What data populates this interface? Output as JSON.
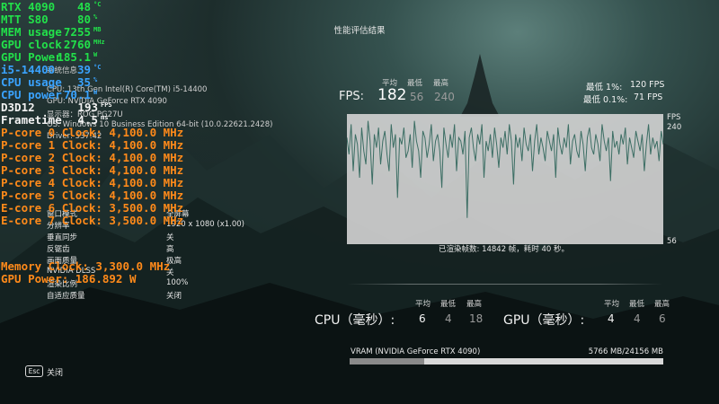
{
  "title": "性能评估结果",
  "osd": [
    {
      "label": "RTX 4090",
      "value": "48",
      "unit": "°C",
      "color": "c-green"
    },
    {
      "label": "MTT S80",
      "value": "80",
      "unit": "%",
      "color": "c-green"
    },
    {
      "label": "MEM usage",
      "value": "7255",
      "unit": "MB",
      "color": "c-green"
    },
    {
      "label": "GPU clock",
      "value": "2760",
      "unit": "MHz",
      "color": "c-green"
    },
    {
      "label": "GPU Power",
      "value": "185.1",
      "unit": "W",
      "color": "c-green"
    },
    {
      "label": "i5-14400",
      "value": "39",
      "unit": "°C",
      "color": "c-blue"
    },
    {
      "label": "CPU usage",
      "value": "35",
      "unit": "%",
      "color": "c-blue"
    },
    {
      "label": "CPU power",
      "value": "70.1",
      "unit": "W",
      "color": "c-blue"
    },
    {
      "label": "D3D12",
      "value": "193",
      "unit": "FPS",
      "color": "c-white"
    },
    {
      "label": "Frametime",
      "value": "4.5",
      "unit": "ms",
      "color": "c-white"
    }
  ],
  "osd_clocks": [
    "P-core 0 Clock: 4,100.0 MHz",
    "P-core 1 Clock: 4,100.0 MHz",
    "P-core 2 Clock: 4,100.0 MHz",
    "P-core 3 Clock: 4,100.0 MHz",
    "P-core 4 Clock: 4,100.0 MHz",
    "P-core 5 Clock: 4,100.0 MHz",
    "E-core 6 Clock: 3,500.0 MHz",
    "E-core 7 Clock: 3,500.0 MHz"
  ],
  "osd_bottom": [
    "Memory Clock: 3,300.0 MHz",
    "GPU Power: 186.892 W"
  ],
  "sysinfo": {
    "header": "系统信息",
    "cpu": "CPU: 13th Gen Intel(R) Core(TM) i5-14400",
    "gpu": "GPU: NVIDIA GeForce RTX 4090",
    "display": "显示器：ROG PG27U",
    "os": "OS: Windows 10 Business Edition 64-bit (10.0.22621.2428)",
    "driver": "Driver: 537.42"
  },
  "settings": [
    {
      "key": "窗口模式",
      "value": "全屏幕"
    },
    {
      "key": "分辨率",
      "value": "1920 x 1080 (x1.00)"
    },
    {
      "key": "垂直同步",
      "value": "关"
    },
    {
      "key": "反锯齿",
      "value": "高"
    },
    {
      "key": "画面质量",
      "value": "极高"
    },
    {
      "key": "NVIDIA DLSS",
      "value": "关"
    },
    {
      "key": "渲染比例",
      "value": "100%"
    },
    {
      "key": "自适应质量",
      "value": "关闭"
    }
  ],
  "fps": {
    "label": "FPS:",
    "avg_header": "平均",
    "min_header": "最低",
    "max_header": "最高",
    "avg": "182",
    "min": "56",
    "max": "240",
    "low1_label": "最低 1%:",
    "low1_value": "120 FPS",
    "low01_label": "最低 0.1%:",
    "low01_value": "71 FPS",
    "y_unit": "FPS",
    "y_max": "240",
    "y_min": "56",
    "caption": "已渲染帧数: 14842 帧，耗时 40 秒。"
  },
  "cpu": {
    "label": "CPU（毫秒）:",
    "avg_header": "平均",
    "min_header": "最低",
    "max_header": "最高",
    "avg": "6",
    "min": "4",
    "max": "18"
  },
  "gpu": {
    "label": "GPU（毫秒）:",
    "avg_header": "平均",
    "min_header": "最低",
    "max_header": "最高",
    "avg": "4",
    "min": "4",
    "max": "6"
  },
  "vram": {
    "label": "VRAM (NVIDIA GeForce RTX 4090)",
    "value": "5766 MB/24156 MB",
    "used_fraction": 0.239
  },
  "footer": {
    "esc_key": "Esc",
    "close_label": "关闭"
  },
  "chart_data": {
    "type": "line",
    "ylabel": "FPS",
    "ylim": [
      56,
      240
    ],
    "summary": {
      "avg": 182,
      "min": 56,
      "max": 240
    },
    "y": [
      210,
      185,
      230,
      160,
      215,
      200,
      150,
      225,
      190,
      170,
      235,
      205,
      140,
      215,
      195,
      225,
      170,
      205,
      220,
      185,
      160,
      230,
      195,
      215,
      120,
      210,
      200,
      225,
      180,
      190,
      215,
      165,
      235,
      205,
      190,
      150,
      220,
      210,
      180,
      200,
      230,
      175,
      205,
      215,
      190,
      135,
      225,
      200,
      180,
      215,
      195,
      230,
      160,
      210,
      205,
      185,
      220,
      90,
      210,
      225,
      195,
      175,
      215,
      200,
      230,
      150,
      205,
      190,
      215,
      180,
      225,
      200,
      165,
      210,
      195,
      220,
      185,
      230,
      205,
      140,
      215,
      195,
      210,
      175,
      225,
      200,
      190,
      215,
      160,
      205,
      230,
      185,
      210,
      195,
      175,
      220,
      205,
      190,
      215,
      150,
      225,
      200,
      185,
      210,
      195,
      230,
      170,
      205,
      215,
      190,
      180,
      220,
      200,
      160,
      210,
      225,
      195,
      185,
      215,
      200,
      175,
      230,
      205,
      190,
      210,
      145,
      220,
      195,
      205,
      185,
      215,
      200,
      225,
      170,
      210,
      195,
      180,
      220,
      205,
      190,
      215,
      160,
      200,
      230,
      185,
      210,
      195,
      205,
      175,
      220,
      200
    ]
  }
}
